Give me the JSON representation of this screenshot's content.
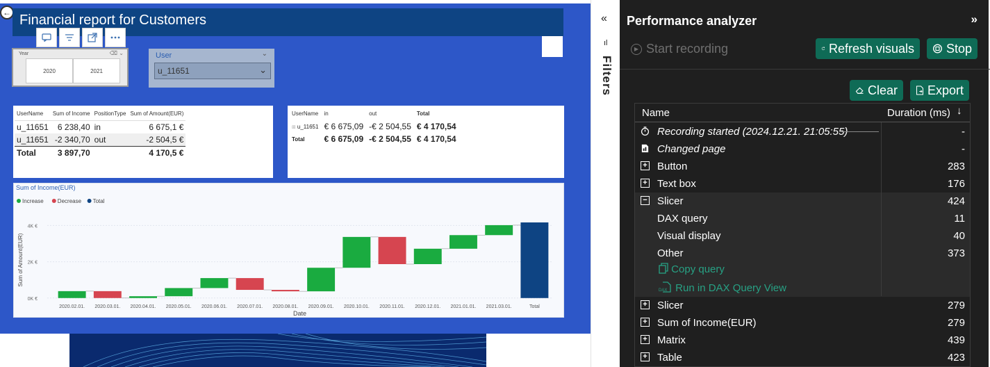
{
  "report": {
    "title": "Financial report for Customers",
    "year_slicer": {
      "label": "Year",
      "options": [
        "2020",
        "2021"
      ]
    },
    "user_slicer": {
      "label": "User",
      "selected": "u_11651"
    },
    "table_left": {
      "headers": [
        "UserName",
        "Sum of Income",
        "PositionType",
        "Sum of Amount(EUR)"
      ],
      "rows": [
        [
          "u_11651",
          "6 238,40",
          "in",
          "6 675,1 €"
        ],
        [
          "u_11651",
          "-2 340,70",
          "out",
          "-2 504,5 €"
        ]
      ],
      "total": [
        "Total",
        "3 897,70",
        "",
        "4 170,5 €"
      ]
    },
    "table_right": {
      "headers": [
        "UserName",
        "in",
        "out",
        "Total"
      ],
      "rows": [
        [
          "u_11651",
          "€ 6 675,09",
          "-€ 2 504,55",
          "€ 4 170,54"
        ]
      ],
      "total": [
        "Total",
        "€ 6 675,09",
        "-€ 2 504,55",
        "€ 4 170,54"
      ]
    }
  },
  "chart_data": {
    "type": "bar",
    "subtype": "waterfall",
    "title": "Sum of Income(EUR)",
    "xlabel": "Date",
    "ylabel": "Sum of Amount(EUR)",
    "legend": [
      {
        "name": "Increase",
        "color": "#1aab40"
      },
      {
        "name": "Decrease",
        "color": "#d64550"
      },
      {
        "name": "Total",
        "color": "#0e4483"
      }
    ],
    "legend_position": "top-left",
    "y_ticks": [
      "0K €",
      "2K €",
      "4K €"
    ],
    "ylim": [
      -200,
      4400
    ],
    "categories": [
      "2020.02.01.",
      "2020.03.01.",
      "2020.04.01.",
      "2020.05.01.",
      "2020.06.01.",
      "2020.07.01.",
      "2020.08.01.",
      "2020.09.01.",
      "2020.10.01.",
      "2020.11.01.",
      "2020.12.01.",
      "2021.01.01.",
      "2021.03.01.",
      "Total"
    ],
    "deltas": [
      380,
      -380,
      100,
      450,
      550,
      -650,
      -80,
      1300,
      1700,
      -1500,
      850,
      750,
      550,
      4170
    ],
    "kinds": [
      "increase",
      "decrease",
      "increase",
      "increase",
      "increase",
      "decrease",
      "decrease",
      "increase",
      "increase",
      "decrease",
      "increase",
      "increase",
      "increase",
      "total"
    ]
  },
  "filters": {
    "label": "Filters"
  },
  "perf": {
    "title": "Performance analyzer",
    "start_recording": "Start recording",
    "refresh_visuals": "Refresh visuals",
    "stop": "Stop",
    "clear": "Clear",
    "export": "Export",
    "col_name": "Name",
    "col_duration": "Duration (ms)",
    "rows": [
      {
        "name": "Recording started (2024.12.21. 21:05:55)",
        "duration": "-"
      },
      {
        "name": "Changed page",
        "duration": "-"
      },
      {
        "name": "Button",
        "duration": "283"
      },
      {
        "name": "Text box",
        "duration": "176"
      },
      {
        "name": "Slicer",
        "duration": "424"
      },
      {
        "name": "DAX query",
        "duration": "11"
      },
      {
        "name": "Visual display",
        "duration": "40"
      },
      {
        "name": "Other",
        "duration": "373"
      },
      {
        "name": "Slicer",
        "duration": "279"
      },
      {
        "name": "Sum of Income(EUR)",
        "duration": "279"
      },
      {
        "name": "Matrix",
        "duration": "439"
      },
      {
        "name": "Table",
        "duration": "423"
      }
    ],
    "copy_query": "Copy query",
    "run_in_dax": "Run in DAX Query View",
    "accent_color": "#0f6b56"
  }
}
